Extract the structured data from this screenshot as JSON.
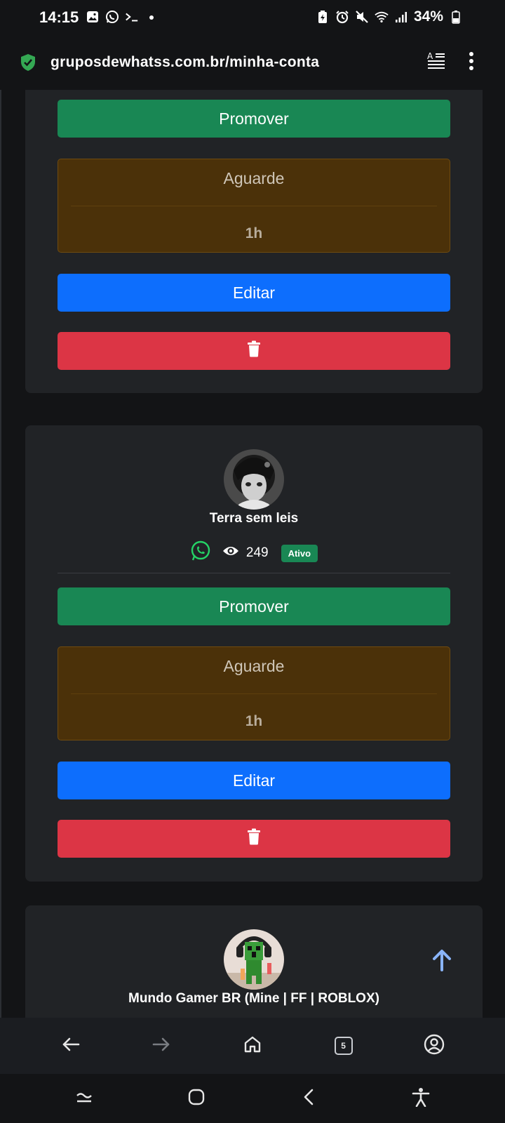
{
  "status_bar": {
    "time": "14:15",
    "battery": "34%",
    "left_icons": [
      "image-icon",
      "whatsapp-icon",
      "terminal-icon",
      "dot-icon"
    ],
    "right_icons": [
      "battery-saver-icon",
      "alarm-icon",
      "mute-icon",
      "wifi-icon",
      "signal-icon",
      "battery-icon"
    ]
  },
  "url_bar": {
    "url": "gruposdewhatss.com.br/minha-conta",
    "secure_icon": "shield-check-icon",
    "reader_icon": "reader-mode-icon",
    "menu_icon": "more-vertical-icon"
  },
  "cards": [
    {
      "promote_label": "Promover",
      "wait_title": "Aguarde",
      "wait_time": "1h",
      "edit_label": "Editar",
      "delete_icon": "trash-icon"
    },
    {
      "name": "Terra sem leis",
      "views": "249",
      "status": "Ativo",
      "promote_label": "Promover",
      "wait_title": "Aguarde",
      "wait_time": "1h",
      "edit_label": "Editar",
      "delete_icon": "trash-icon"
    },
    {
      "name": "Mundo Gamer BR (Mine | FF | ROBLOX)"
    }
  ],
  "colors": {
    "promote": "#198754",
    "edit": "#0d6efd",
    "delete": "#dc3545",
    "wait_bg": "#4b3109",
    "card_bg": "#212326",
    "page_bg": "#131416",
    "whatsapp": "#25d366",
    "scroll_up": "#8ab4f8"
  },
  "browser_nav": {
    "tab_count": "5",
    "items": [
      "back-arrow-icon",
      "forward-arrow-icon",
      "home-icon",
      "tabs-icon",
      "account-icon"
    ]
  },
  "system_nav": {
    "items": [
      "recents-icon",
      "home-circle-icon",
      "back-chevron-icon",
      "accessibility-icon"
    ]
  }
}
